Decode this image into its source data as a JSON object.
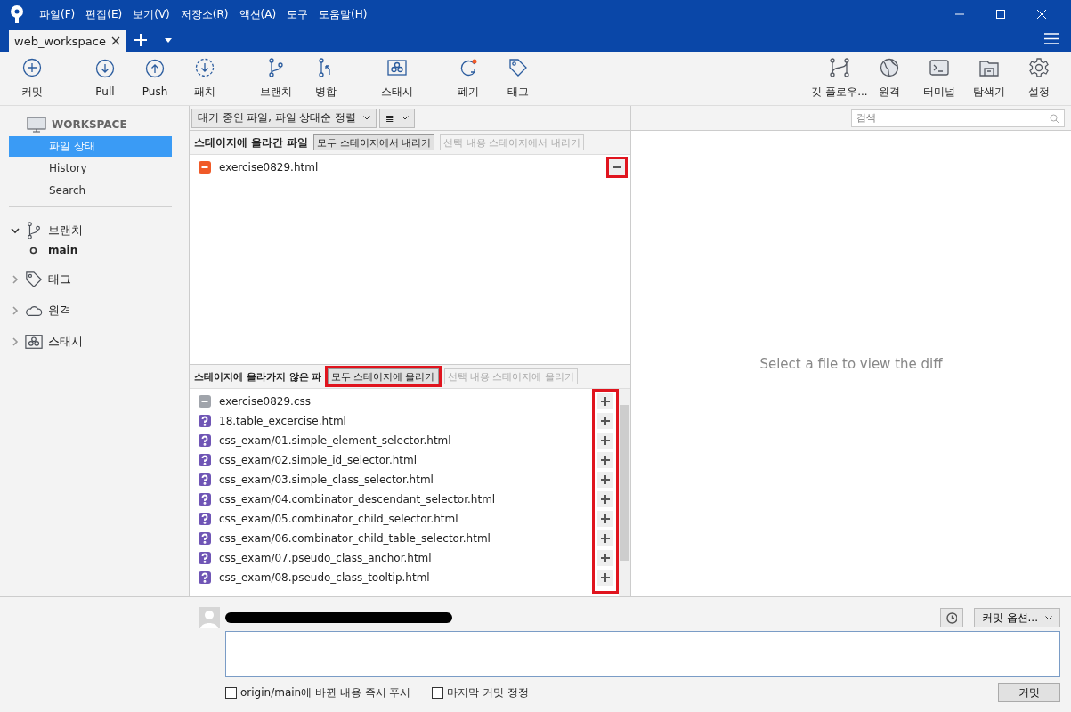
{
  "menu": [
    "파일(F)",
    "편집(E)",
    "보기(V)",
    "저장소(R)",
    "액션(A)",
    "도구",
    "도움말(H)"
  ],
  "tabs": [
    {
      "label": "web_workspace",
      "selected": true
    }
  ],
  "toolbar_left": [
    "커밋",
    "Pull",
    "Push",
    "패치",
    "브랜치",
    "병합",
    "스태시",
    "폐기",
    "태그"
  ],
  "toolbar_right": [
    "깃 플로우...",
    "원격",
    "터미널",
    "탐색기",
    "설정"
  ],
  "sidebar": {
    "workspace": "WORKSPACE",
    "items": [
      {
        "label": "파일 상태",
        "selected": true
      },
      {
        "label": "History",
        "selected": false
      },
      {
        "label": "Search",
        "selected": false
      }
    ],
    "sections": [
      {
        "label": "브랜치",
        "expanded": true,
        "children": [
          {
            "label": "main",
            "current": true
          }
        ]
      },
      {
        "label": "태그",
        "expanded": false
      },
      {
        "label": "원격",
        "expanded": false
      },
      {
        "label": "스태시",
        "expanded": false
      }
    ]
  },
  "filter": {
    "sort": "대기 중인 파일, 파일 상태순 정렬",
    "view": "≣"
  },
  "search": {
    "placeholder": "검색"
  },
  "staged": {
    "title": "스테이지에 올라간 파일",
    "buttons": [
      {
        "label": "모두 스테이지에서 내리기",
        "disabled": false
      },
      {
        "label": "선택 내용 스테이지에서 내리기",
        "disabled": true
      }
    ],
    "files": [
      {
        "name": "exercise0829.html",
        "kind": "deleted"
      }
    ]
  },
  "unstaged": {
    "title": "스테이지에 올라가지 않은 파",
    "buttons": [
      {
        "label": "모두 스테이지에 올리기",
        "disabled": false
      },
      {
        "label": "선택 내용 스테이지에 올리기",
        "disabled": true
      }
    ],
    "files": [
      {
        "name": "exercise0829.css",
        "kind": "missing"
      },
      {
        "name": "18.table_excercise.html",
        "kind": "untracked"
      },
      {
        "name": "css_exam/01.simple_element_selector.html",
        "kind": "untracked"
      },
      {
        "name": "css_exam/02.simple_id_selector.html",
        "kind": "untracked"
      },
      {
        "name": "css_exam/03.simple_class_selector.html",
        "kind": "untracked"
      },
      {
        "name": "css_exam/04.combinator_descendant_selector.html",
        "kind": "untracked"
      },
      {
        "name": "css_exam/05.combinator_child_selector.html",
        "kind": "untracked"
      },
      {
        "name": "css_exam/06.combinator_child_table_selector.html",
        "kind": "untracked"
      },
      {
        "name": "css_exam/07.pseudo_class_anchor.html",
        "kind": "untracked"
      },
      {
        "name": "css_exam/08.pseudo_class_tooltip.html",
        "kind": "untracked"
      }
    ]
  },
  "diff": {
    "empty_message": "Select a file to view the diff"
  },
  "commit": {
    "options": "커밋 옵션...",
    "checkboxes": [
      {
        "label": "origin/main에 바뀐 내용 즉시 푸시",
        "checked": false
      },
      {
        "label": "마지막 커밋 정정",
        "checked": false
      }
    ],
    "button": "커밋"
  }
}
